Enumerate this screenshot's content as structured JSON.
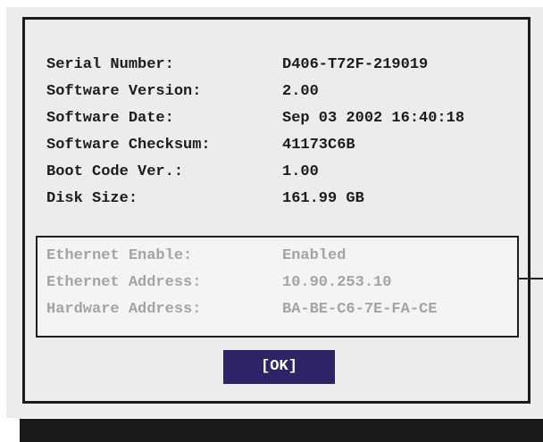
{
  "system_info": [
    {
      "label": "Serial Number:",
      "value": "D406-T72F-219019"
    },
    {
      "label": "Software Version:",
      "value": "2.00"
    },
    {
      "label": "Software Date:",
      "value": "Sep 03 2002 16:40:18"
    },
    {
      "label": "Software Checksum:",
      "value": "41173C6B"
    },
    {
      "label": "Boot Code Ver.:",
      "value": "1.00"
    },
    {
      "label": "Disk Size:",
      "value": "161.99 GB"
    }
  ],
  "network_info": [
    {
      "label": "Ethernet Enable:",
      "value": "Enabled"
    },
    {
      "label": "Ethernet Address:",
      "value": "10.90.253.10"
    },
    {
      "label": "Hardware Address:",
      "value": "BA-BE-C6-7E-FA-CE"
    }
  ],
  "ok_button": {
    "label": "[OK]"
  },
  "colors": {
    "button_bg": "#2c2467",
    "disabled_text": "#a4a4a4",
    "panel_bg": "#ececec"
  }
}
